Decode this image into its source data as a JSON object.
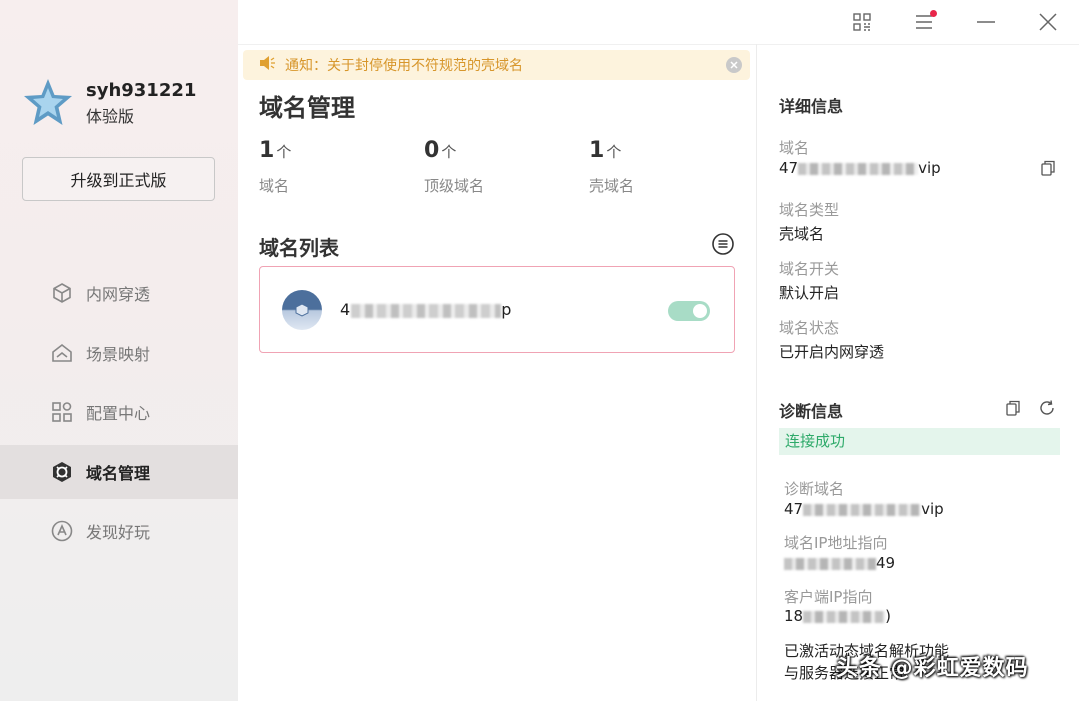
{
  "window": {
    "controls": [
      "qr-code-icon",
      "menu-icon",
      "minimize-icon",
      "close-icon"
    ]
  },
  "sidebar": {
    "username": "syh931221",
    "edition": "体验版",
    "upgrade_label": "升级到正式版",
    "items": [
      {
        "label": "内网穿透",
        "icon": "cube-icon",
        "active": false
      },
      {
        "label": "场景映射",
        "icon": "house-icon",
        "active": false
      },
      {
        "label": "配置中心",
        "icon": "grid-icon",
        "active": false
      },
      {
        "label": "域名管理",
        "icon": "domain-icon",
        "active": true
      },
      {
        "label": "发现好玩",
        "icon": "discover-icon",
        "active": false
      }
    ]
  },
  "notice": {
    "text": "通知：关于封停使用不符规范的壳域名"
  },
  "main": {
    "title": "域名管理",
    "stats": [
      {
        "value": "1",
        "unit": "个",
        "label": "域名"
      },
      {
        "value": "0",
        "unit": "个",
        "label": "顶级域名"
      },
      {
        "value": "1",
        "unit": "个",
        "label": "壳域名"
      }
    ],
    "list_title": "域名列表",
    "domains": [
      {
        "name_start": "4",
        "name_end": "p",
        "enabled": true
      }
    ]
  },
  "details": {
    "title": "详细信息",
    "domain_label": "域名",
    "domain_value_start": "47",
    "domain_value_end": "vip",
    "type_label": "域名类型",
    "type_value": "壳域名",
    "switch_label": "域名开关",
    "switch_value": "默认开启",
    "status_label": "域名状态",
    "status_value": "已开启内网穿透"
  },
  "diagnosis": {
    "title": "诊断信息",
    "status": "连接成功",
    "diag_domain_label": "诊断域名",
    "diag_domain_start": "47",
    "diag_domain_end": "vip",
    "ip_label": "域名IP地址指向",
    "ip_value_end": "49",
    "client_ip_label": "客户端IP指向",
    "client_ip_start": "18",
    "client_ip_end": ")",
    "note_line1": "已激活动态域名解析功能",
    "note_line2": "与服务器连接正常"
  },
  "watermark": "头条 @彩虹爱数码",
  "colors": {
    "accent_green": "#2eaa6a",
    "notice_text": "#d7962b",
    "card_border": "#f0a3b4",
    "badge_dot": "#e8264a"
  }
}
